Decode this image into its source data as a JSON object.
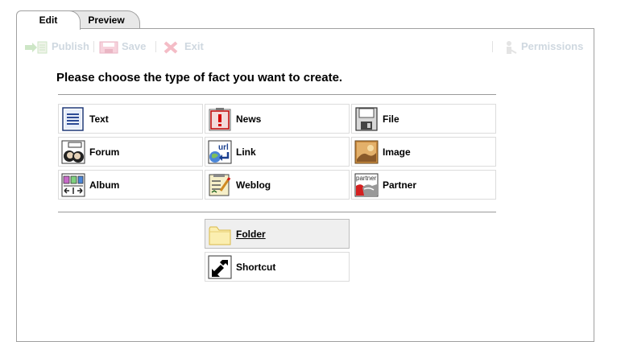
{
  "tabs": {
    "edit": "Edit",
    "preview": "Preview"
  },
  "toolbar": {
    "publish": "Publish",
    "save": "Save",
    "exit": "Exit",
    "permissions": "Permissions",
    "icons": {
      "publish": "publish-icon",
      "save": "save-icon",
      "exit": "exit-icon",
      "permissions": "permissions-icon"
    },
    "disabled_color": "#cfd8e0"
  },
  "heading": "Please choose the type of fact you want to create.",
  "fact_types": [
    {
      "label": "Text",
      "icon": "text-document-icon"
    },
    {
      "label": "News",
      "icon": "news-icon"
    },
    {
      "label": "File",
      "icon": "file-floppy-icon"
    },
    {
      "label": "Forum",
      "icon": "forum-icon"
    },
    {
      "label": "Link",
      "icon": "link-url-icon"
    },
    {
      "label": "Image",
      "icon": "image-icon"
    },
    {
      "label": "Album",
      "icon": "album-icon"
    },
    {
      "label": "Weblog",
      "icon": "weblog-icon"
    },
    {
      "label": "Partner",
      "icon": "partner-icon"
    }
  ],
  "structure_types": [
    {
      "label": "Folder",
      "icon": "folder-icon",
      "highlighted": true
    },
    {
      "label": "Shortcut",
      "icon": "shortcut-icon",
      "highlighted": false
    }
  ]
}
